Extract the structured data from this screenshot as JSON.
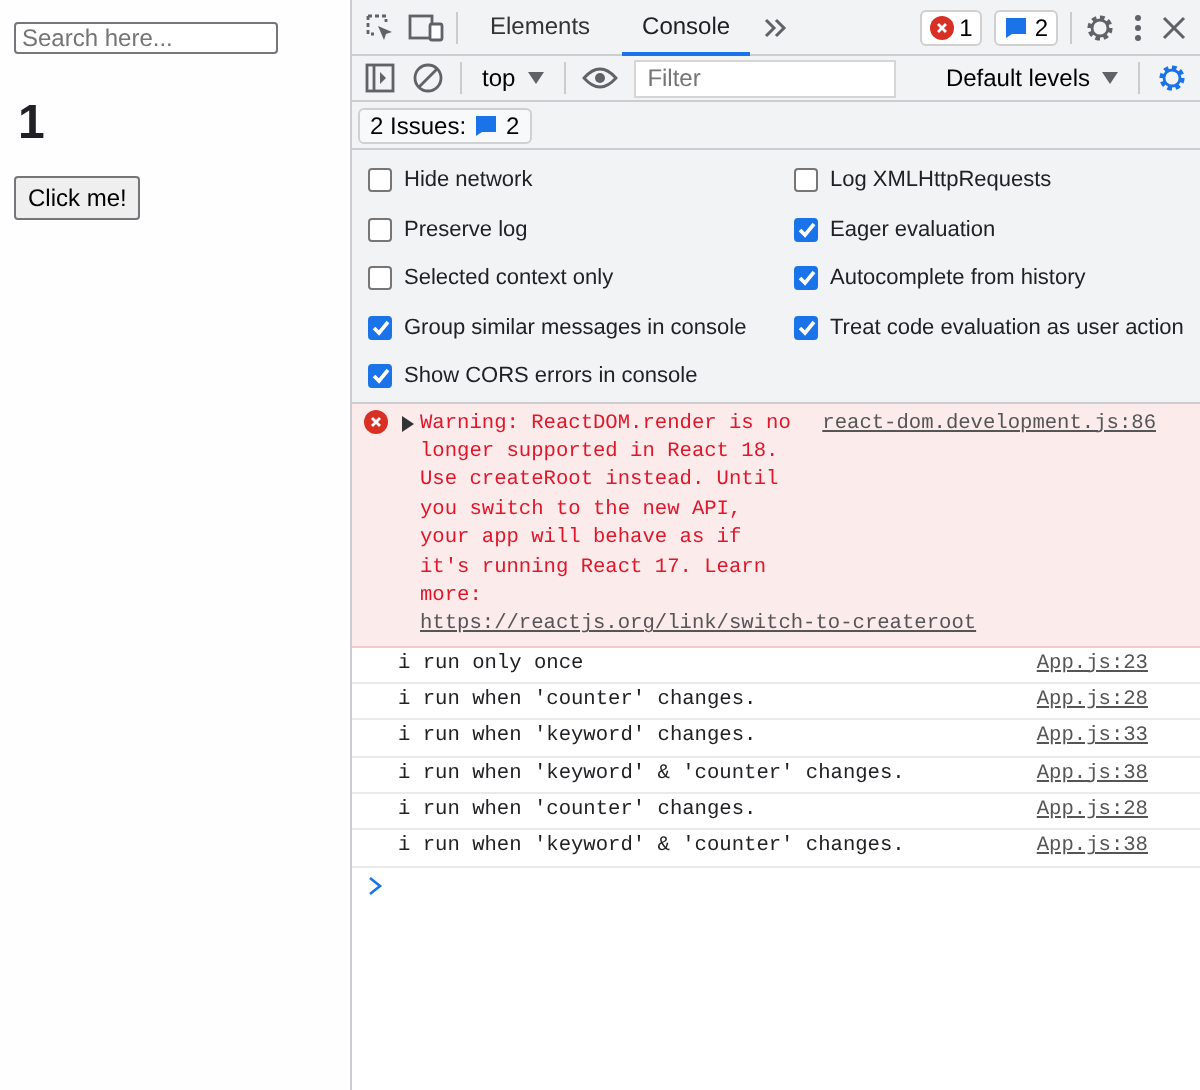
{
  "page": {
    "search": {
      "placeholder": "Search here..."
    },
    "counter": "1",
    "button": "Click me!"
  },
  "devtools": {
    "tabs": [
      {
        "label": "Elements",
        "selected": false
      },
      {
        "label": "Console",
        "selected": true
      }
    ],
    "error_count": "1",
    "issue_count": "2",
    "toolbar": {
      "context": "top",
      "filter": {
        "placeholder": "Filter"
      },
      "levels": "Default levels"
    },
    "issues": {
      "label": "2 Issues:",
      "count": "2"
    },
    "settings_left": [
      {
        "label": "Hide network",
        "checked": false
      },
      {
        "label": "Preserve log",
        "checked": false
      },
      {
        "label": "Selected context only",
        "checked": false
      },
      {
        "label": "Group similar messages in console",
        "checked": true
      },
      {
        "label": "Show CORS errors in console",
        "checked": true
      }
    ],
    "settings_right": [
      {
        "label": "Log XMLHttpRequests",
        "checked": false
      },
      {
        "label": "Eager evaluation",
        "checked": true
      },
      {
        "label": "Autocomplete from history",
        "checked": true
      },
      {
        "label": "Treat code evaluation as user action",
        "checked": true
      }
    ],
    "messages": [
      {
        "kind": "error",
        "text": "Warning: ReactDOM.render is no longer supported in React 18. Use createRoot instead. Until you switch to the new API, your app will behave as if it's running React 17. Learn more: ",
        "link": "https://reactjs.org/link/switch-to-createroot",
        "source": "react-dom.development.js:86"
      },
      {
        "kind": "log",
        "text": "i run only once",
        "source": "App.js:23"
      },
      {
        "kind": "log",
        "text": "i run when 'counter' changes.",
        "source": "App.js:28"
      },
      {
        "kind": "log",
        "text": "i run when 'keyword' changes.",
        "source": "App.js:33"
      },
      {
        "kind": "log",
        "text": "i run when 'keyword' & 'counter' changes.",
        "source": "App.js:38"
      },
      {
        "kind": "log",
        "text": "i run when 'counter' changes.",
        "source": "App.js:28"
      },
      {
        "kind": "log",
        "text": "i run when 'keyword' & 'counter' changes.",
        "source": "App.js:38"
      }
    ]
  }
}
